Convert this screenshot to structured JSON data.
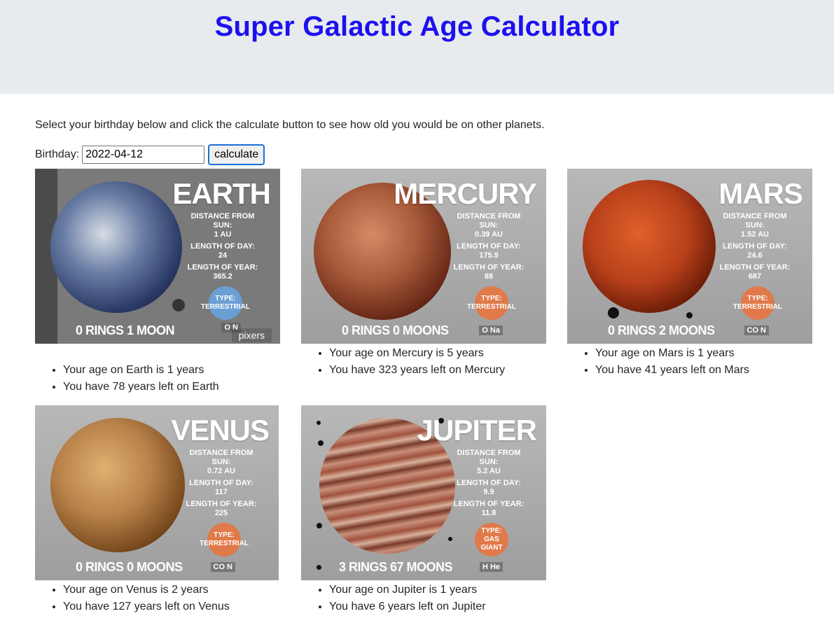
{
  "header": {
    "title": "Super Galactic Age Calculator"
  },
  "intro": "Select your birthday below and click the calculate button to see how old you would be on other planets.",
  "form": {
    "birthday_label": "Birthday:",
    "birthday_value": "2022-04-12",
    "calculate_label": "calculate"
  },
  "planets": [
    {
      "name": "EARTH",
      "facts": [
        "DISTANCE FROM SUN:",
        "1 AU",
        "LENGTH OF DAY:",
        "24",
        "LENGTH OF YEAR:",
        "365.2"
      ],
      "type": "TYPE: TERRESTRIAL",
      "rings": "0 RINGS  1 MOON",
      "elements": "O N",
      "watermark": "pixers",
      "age_text": "Your age on Earth is 1 years",
      "left_text": "You have 78 years left on Earth",
      "colors": {
        "globe": "#3d5a8a",
        "badge": "#6a9fd6"
      }
    },
    {
      "name": "MERCURY",
      "facts": [
        "DISTANCE FROM SUN:",
        "0.39 AU",
        "LENGTH OF DAY:",
        "175.9",
        "LENGTH OF YEAR:",
        "88"
      ],
      "type": "TYPE: TERRESTRIAL",
      "rings": "0 RINGS  0 MOONS",
      "elements": "O Na",
      "watermark": "",
      "age_text": "Your age on Mercury is 5 years",
      "left_text": "You have 323 years left on Mercury",
      "colors": {
        "globe": "#8a4a30",
        "badge": "#e07a4a"
      }
    },
    {
      "name": "MARS",
      "facts": [
        "DISTANCE FROM SUN:",
        "1.52 AU",
        "LENGTH OF DAY:",
        "24.6",
        "LENGTH OF YEAR:",
        "687"
      ],
      "type": "TYPE: TERRESTRIAL",
      "rings": "0 RINGS  2 MOONS",
      "elements": "CO N",
      "watermark": "",
      "age_text": "Your age on Mars is 1 years",
      "left_text": "You have 41 years left on Mars",
      "colors": {
        "globe": "#a03a18",
        "badge": "#e07a4a"
      }
    },
    {
      "name": "VENUS",
      "facts": [
        "DISTANCE FROM SUN:",
        "0.72 AU",
        "LENGTH OF DAY:",
        "117",
        "LENGTH OF YEAR:",
        "225"
      ],
      "type": "TYPE: TERRESTRIAL",
      "rings": "0 RINGS  0 MOONS",
      "elements": "CO N",
      "watermark": "",
      "age_text": "Your age on Venus is 2 years",
      "left_text": "You have 127 years left on Venus",
      "colors": {
        "globe": "#9a6a30",
        "badge": "#e07a4a"
      }
    },
    {
      "name": "JUPITER",
      "facts": [
        "DISTANCE FROM SUN:",
        "5.2 AU",
        "LENGTH OF DAY:",
        "9.9",
        "LENGTH OF YEAR:",
        "11.8"
      ],
      "type": "TYPE: GAS GIANT",
      "rings": "3 RINGS  67 MOONS",
      "elements": "H He",
      "watermark": "",
      "age_text": "Your age on Jupiter is 1 years",
      "left_text": "You have 6 years left on Jupiter",
      "colors": {
        "globe": "#8a4a3a",
        "badge": "#e07a4a"
      }
    }
  ]
}
